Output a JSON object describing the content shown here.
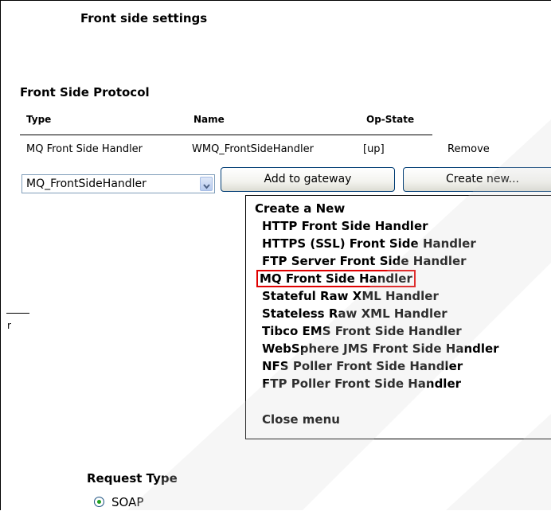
{
  "page": {
    "title": "Front side settings",
    "section_title": "Front Side Protocol"
  },
  "table": {
    "headers": {
      "type": "Type",
      "name": "Name",
      "op_state": "Op-State"
    },
    "row": {
      "type": "MQ Front Side Handler",
      "name": "WMQ_FrontSideHandler",
      "op_state": "[up]",
      "action": "Remove"
    }
  },
  "controls": {
    "select_value": "MQ_FrontSideHandler",
    "add_button": "Add to gateway",
    "create_button": "Create new..."
  },
  "menu": {
    "heading": "Create a New",
    "items": [
      "HTTP Front Side Handler",
      "HTTPS (SSL) Front Side Handler",
      "FTP Server Front Side Handler",
      "MQ Front Side Handler",
      "Stateful Raw XML Handler",
      "Stateless Raw XML Handler",
      "Tibco EMS Front Side Handler",
      "WebSphere JMS Front Side Handler",
      "NFS Poller Front Side Handler",
      "FTP Poller Front Side Handler"
    ],
    "highlighted": "MQ Front Side Handler",
    "close": "Close menu"
  },
  "left_fragment": "r",
  "request": {
    "label": "Request Type",
    "option": "SOAP",
    "selected": true
  },
  "colors": {
    "highlight_border": "#e00000",
    "radio_dot": "#21a121",
    "button_border": "#003c74"
  }
}
